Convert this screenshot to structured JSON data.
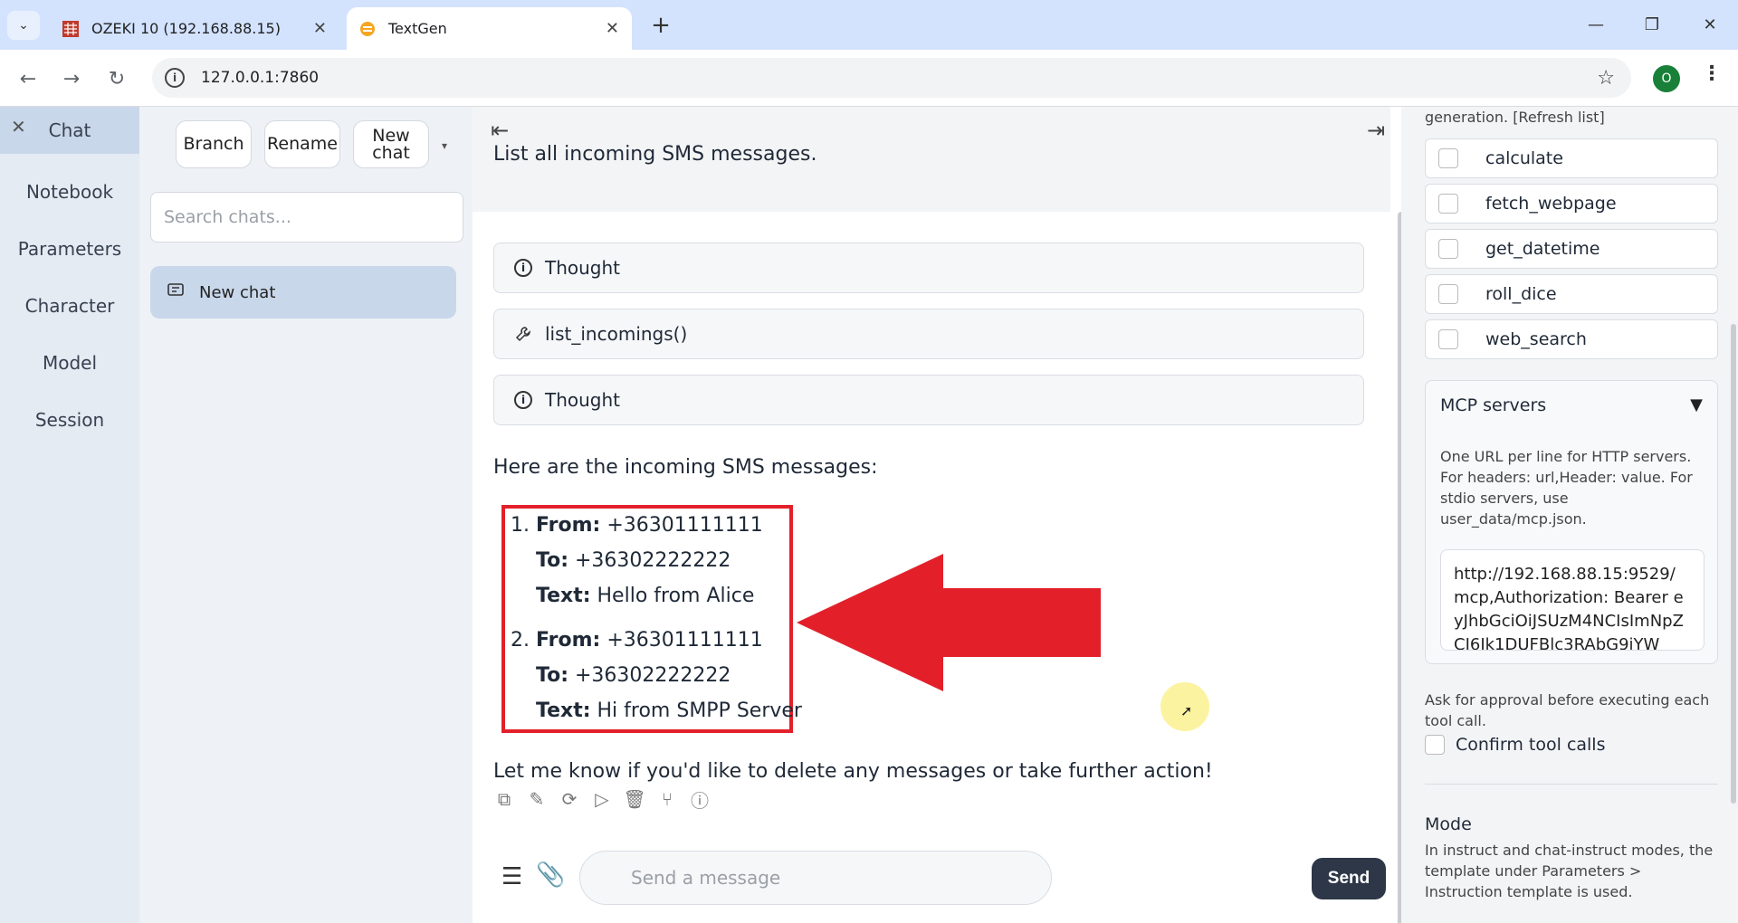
{
  "browser": {
    "tabs": [
      {
        "title": "OZEKI 10 (192.168.88.15)",
        "active": false
      },
      {
        "title": "TextGen",
        "active": true
      }
    ],
    "url": "127.0.0.1:7860",
    "profile_initial": "O"
  },
  "nav": {
    "items": [
      "Chat",
      "Notebook",
      "Parameters",
      "Character",
      "Model",
      "Session"
    ],
    "active": "Chat"
  },
  "chatlist": {
    "branch_label": "Branch",
    "rename_label": "Rename",
    "new_chat_label": "New chat",
    "search_placeholder": "Search chats...",
    "entries": [
      "New chat"
    ]
  },
  "chat": {
    "user_message": "List all incoming SMS messages.",
    "accordions": [
      {
        "label": "Thought",
        "icon": "info-icon"
      },
      {
        "label": "list_incomings()",
        "icon": "wrench-icon"
      },
      {
        "label": "Thought",
        "icon": "info-icon"
      }
    ],
    "intro": "Here are the incoming SMS messages:",
    "messages": [
      {
        "num": "1.",
        "from_label": "From:",
        "from": "+36301111111",
        "to_label": "To:",
        "to": "+36302222222",
        "text_label": "Text:",
        "text": "Hello from Alice"
      },
      {
        "num": "2.",
        "from_label": "From:",
        "from": "+36301111111",
        "to_label": "To:",
        "to": "+36302222222",
        "text_label": "Text:",
        "text": "Hi from SMPP Server"
      }
    ],
    "outro": "Let me know if you'd like to delete any messages or take further action!",
    "input_placeholder": "Send a message",
    "send_label": "Send",
    "highlight_color": "#e3202a"
  },
  "sidebar": {
    "note": "generation. [Refresh list]",
    "tools": [
      "calculate",
      "fetch_webpage",
      "get_datetime",
      "roll_dice",
      "web_search"
    ],
    "mcp": {
      "title": "MCP servers",
      "description": "One URL per line for HTTP servers. For headers: url,Header: value. For stdio servers, use user_data/mcp.json.",
      "value": "http://192.168.88.15:9529/mcp,Authorization: Bearer eyJhbGciOiJSUzM4NCIsImNpZCI6Ik1DUFBlc3RAbG9iYW"
    },
    "approval_note": "Ask for approval before executing each tool call.",
    "confirm_label": "Confirm tool calls",
    "mode_title": "Mode",
    "mode_desc": "In instruct and chat-instruct modes, the template under Parameters > Instruction template is used."
  }
}
